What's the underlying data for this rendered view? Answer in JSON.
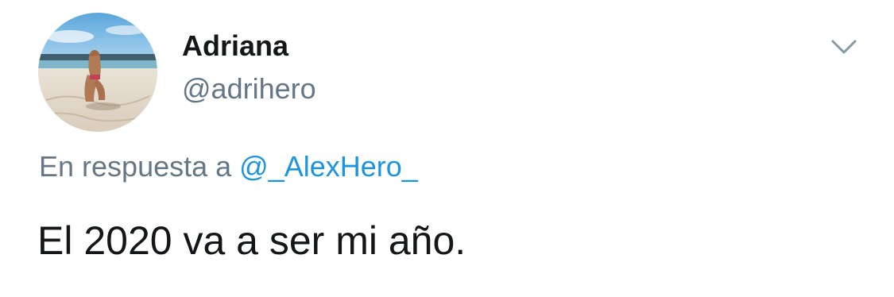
{
  "tweet": {
    "author": {
      "display_name": "Adriana",
      "handle": "@adrihero"
    },
    "reply": {
      "prefix": "En respuesta a",
      "mention": "@_AlexHero_"
    },
    "text": "El 2020 va a ser mi año."
  },
  "icons": {
    "menu": "chevron-down-icon",
    "avatar": "avatar"
  },
  "colors": {
    "text_primary": "#14171a",
    "text_secondary": "#657786",
    "link": "#1b95e0"
  }
}
